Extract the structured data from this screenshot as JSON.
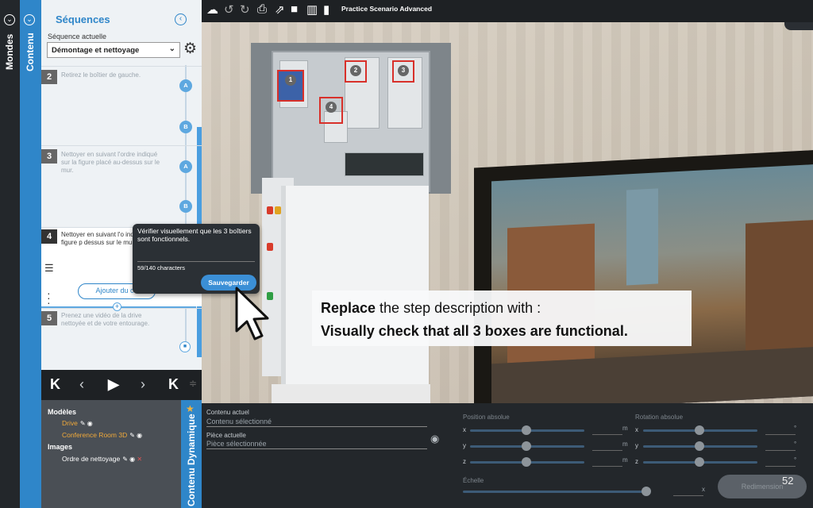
{
  "left_rail": {
    "mondes_label": "Mondes",
    "contenu_label": "Contenu"
  },
  "sequences": {
    "title": "Séquences",
    "current_label": "Séquence actuelle",
    "current_value": "Démontage et nettoyage",
    "steps": [
      {
        "num": "2",
        "text": "Retirez le boîtier de gauche."
      },
      {
        "num": "3",
        "text": "Nettoyer en suivant l'ordre indiqué sur la figure placé au-dessus sur le mur."
      },
      {
        "num": "4",
        "text": "Nettoyer en suivant l'o indiqué sur la figure p dessus sur le mur."
      },
      {
        "num": "5",
        "text": "Prenez une vidéo de la drive nettoyée et de votre entourage."
      }
    ],
    "nodes": [
      "A",
      "B",
      "A",
      "B"
    ],
    "add_content_label": "Ajouter du co"
  },
  "popup": {
    "text": "Vérifier visuellement que les 3 boîtiers sont fonctionnels.",
    "count": "59/140 characters",
    "save_label": "Sauvegarder"
  },
  "models_panel": {
    "models_heading": "Modèles",
    "models": [
      "Drive",
      "Conference Room 3D"
    ],
    "images_heading": "Images",
    "images": [
      "Ordre de nettoyage"
    ],
    "dynamic_label": "Contenu Dynamique"
  },
  "toolbar": {
    "scenario_title": "Practice Scenario Advanced"
  },
  "instruction": {
    "line1_bold": "Replace",
    "line1_rest": " the step description with :",
    "line2": "Visually check that all 3 boxes are functional."
  },
  "scene_labels": [
    "1",
    "2",
    "3",
    "4"
  ],
  "properties": {
    "current_content_label": "Contenu actuel",
    "current_content_value": "Contenu sélectionné",
    "current_piece_label": "Pièce actuelle",
    "current_piece_value": "Pièce sélectionnée",
    "position_label": "Position absolue",
    "rotation_label": "Rotation absolue",
    "scale_label": "Échelle",
    "axes": [
      "x",
      "y",
      "z"
    ],
    "pos_unit": "m",
    "rot_unit": "°",
    "scale_unit": "x",
    "resize_label": "Redimension"
  },
  "page_number": "52"
}
